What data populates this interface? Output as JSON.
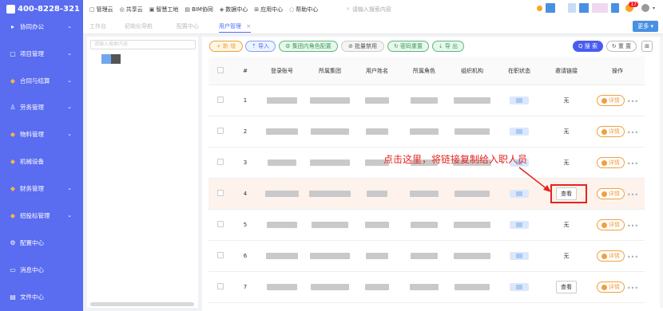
{
  "sidebar": {
    "phone": "400-8228-321",
    "items": [
      {
        "label": "协同办公",
        "icon": "arrow-right-icon",
        "chevron": true
      },
      {
        "label": "项目管理",
        "icon": "project-icon",
        "chevron": true
      },
      {
        "label": "合同与结算",
        "icon": "diamond-icon",
        "chevron": true
      },
      {
        "label": "劳务管理",
        "icon": "person-icon",
        "chevron": true
      },
      {
        "label": "物料管理",
        "icon": "diamond-icon",
        "chevron": true
      },
      {
        "label": "机械设备",
        "icon": "diamond-icon",
        "chevron": false
      },
      {
        "label": "财务管理",
        "icon": "diamond-icon",
        "chevron": true
      },
      {
        "label": "招投标管理",
        "icon": "diamond-icon",
        "chevron": true
      },
      {
        "label": "配置中心",
        "icon": "gear-icon",
        "chevron": false
      },
      {
        "label": "消息中心",
        "icon": "message-icon",
        "chevron": false
      },
      {
        "label": "文件中心",
        "icon": "file-icon",
        "chevron": false
      }
    ]
  },
  "topnav": {
    "items": [
      {
        "label": "管理云",
        "icon": "cloud-icon"
      },
      {
        "label": "共享云",
        "icon": "share-icon"
      },
      {
        "label": "智慧工地",
        "icon": "site-icon"
      },
      {
        "label": "BIM协同",
        "icon": "bim-icon"
      },
      {
        "label": "数据中心",
        "icon": "data-icon"
      },
      {
        "label": "应用中心",
        "icon": "apps-icon"
      },
      {
        "label": "帮助中心",
        "icon": "help-icon"
      }
    ],
    "search_placeholder": "请输入搜索内容",
    "notification_count": "17"
  },
  "tabs": {
    "items": [
      "工作台",
      "初始化导航",
      "配置中心",
      "用户管理"
    ],
    "active_index": 3,
    "more_label": "更多"
  },
  "tree": {
    "search_placeholder": "请输入搜索内容"
  },
  "toolbar": {
    "new_label": "+ 新 增",
    "import_label": "⇡ 导入",
    "role_config_label": "⚙ 集团内角色配置",
    "batch_disable_label": "⊘ 批量禁用",
    "reset_pwd_label": "↻ 密码重置",
    "export_label": "⇣ 导 出",
    "search_label": "Q 搜 索",
    "reset_label": "↻ 重 置"
  },
  "table": {
    "headers": [
      "#",
      "登录账号",
      "所属集团",
      "用户姓名",
      "所属角色",
      "组织机构",
      "在职状态",
      "邀请链接",
      "操作"
    ],
    "rows": [
      {
        "index": "1",
        "link": "无",
        "view": false
      },
      {
        "index": "2",
        "link": "无",
        "view": false
      },
      {
        "index": "3",
        "link": "无",
        "view": false
      },
      {
        "index": "4",
        "link": "查看",
        "view": true
      },
      {
        "index": "5",
        "link": "无",
        "view": false
      },
      {
        "index": "6",
        "link": "无",
        "view": false
      },
      {
        "index": "7",
        "link": "查看",
        "view": true
      }
    ],
    "detail_label": "详情",
    "highlight_row": 3
  },
  "annotation": {
    "text": "点击这里，将链接复制给入职人员",
    "color": "#e5241f"
  },
  "colors": {
    "sidebar": "#5a6cf0",
    "primary": "#4a6cf7",
    "accent_orange": "#f0a040"
  }
}
